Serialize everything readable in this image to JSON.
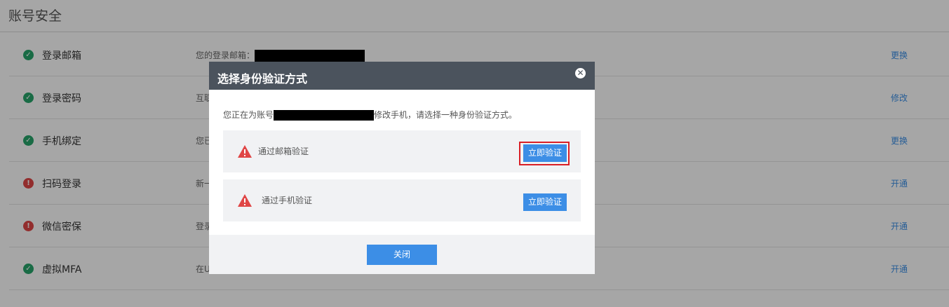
{
  "page": {
    "title": "账号安全"
  },
  "rows": [
    {
      "name": "登录邮箱",
      "status": "ok",
      "desc_prefix": "您的登录邮箱：",
      "action": "更换"
    },
    {
      "name": "登录密码",
      "status": "ok",
      "desc_prefix": "互联",
      "action": "修改"
    },
    {
      "name": "手机绑定",
      "status": "ok",
      "desc_prefix": "您已",
      "action": "更换"
    },
    {
      "name": "扫码登录",
      "status": "warn",
      "desc_prefix": "新一",
      "action": "开通"
    },
    {
      "name": "微信密保",
      "status": "warn",
      "desc_prefix": "登录",
      "action": "开通"
    },
    {
      "name": "虚拟MFA",
      "status": "ok",
      "desc_prefix": "在U",
      "action": "开通"
    }
  ],
  "modal": {
    "title": "选择身份验证方式",
    "prompt_prefix": "您正在为账号",
    "prompt_suffix": "修改手机，请选择一种身份验证方式。",
    "options": [
      {
        "label": "通过邮箱验证",
        "button": "立即验证"
      },
      {
        "label": "通过手机验证",
        "button": "立即验证"
      }
    ],
    "close_button": "关闭"
  },
  "colors": {
    "accent": "#3c8ee6",
    "header": "#4b535d",
    "ok": "#27a56a",
    "warn": "#e04646",
    "highlight": "#d91f26"
  },
  "icons": {
    "ok": "check-circle-icon",
    "warn": "exclamation-circle-icon",
    "option": "warning-triangle-icon",
    "close": "close-icon"
  }
}
